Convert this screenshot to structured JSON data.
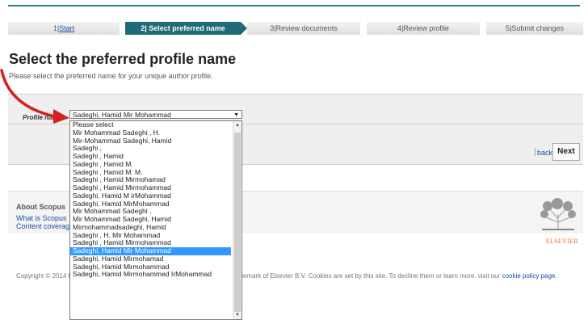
{
  "steps": [
    {
      "num": "1",
      "label": "Start"
    },
    {
      "num": "2",
      "label": "Select preferred name"
    },
    {
      "num": "3",
      "label": "Review documents"
    },
    {
      "num": "4",
      "label": "Review profile"
    },
    {
      "num": "5",
      "label": "Submit changes"
    }
  ],
  "page": {
    "title": "Select the preferred profile name",
    "subtitle": "Please select the preferred name for your unique author profile."
  },
  "form": {
    "label": "Profile name",
    "selected": "Sadeghi, Hamid Mir Mohammad",
    "options": [
      "Please select",
      "Mir Mohammad Sadeghi , H.",
      "Mir-Mohammad Sadeghi, Hamid",
      "Sadeghi ,",
      "Sadeghi , Hamid",
      "Sadeghi , Hamid M.",
      "Sadeghi , Hamid M. M.",
      "Sadeghi , Hamid Mirmohamad",
      "Sadeghi , Hamid Mirmohammad",
      "Sadeghi, Hamid M irMohammad",
      "Sadeghi, Hamid MirMohammad",
      "Mir Mohammad Sadeghi ,",
      "Mir Mohammad Sadeghi, Hamid",
      "Mirmohammadsadeghi, Hamid",
      "Sadeghi , H. Mir Mohammad",
      "Sadeghi , Hamid Mirmohammad",
      "Sadeghi, Hamid Mir Mohammad",
      "Sadeghi, Hamid Mirmohamad",
      "Sadeghi, Hamid Mirmohammad",
      "Sadeghi, Hamid Mirmohammed IrMohammad"
    ],
    "highlighted_index": 16
  },
  "nav": {
    "back": "back",
    "separator": "|",
    "next": "Next"
  },
  "footer": {
    "about": "About Scopus",
    "links": [
      "What is Scopus",
      "Content coverage"
    ],
    "logo_text": "ELSEVIER",
    "copyright": "Copyright © 2014 Elsevier B.V. All rights reserved. Scopus® is a registered trademark of Elsevier B.V. Cookies are set by this site. To decline them or learn more, visit our",
    "cookie_link": "cookie policy page."
  },
  "colors": {
    "step_active": "#1f6b77",
    "highlight": "#3399ff",
    "link": "#1a4fa0",
    "arrow": "#d42020"
  }
}
